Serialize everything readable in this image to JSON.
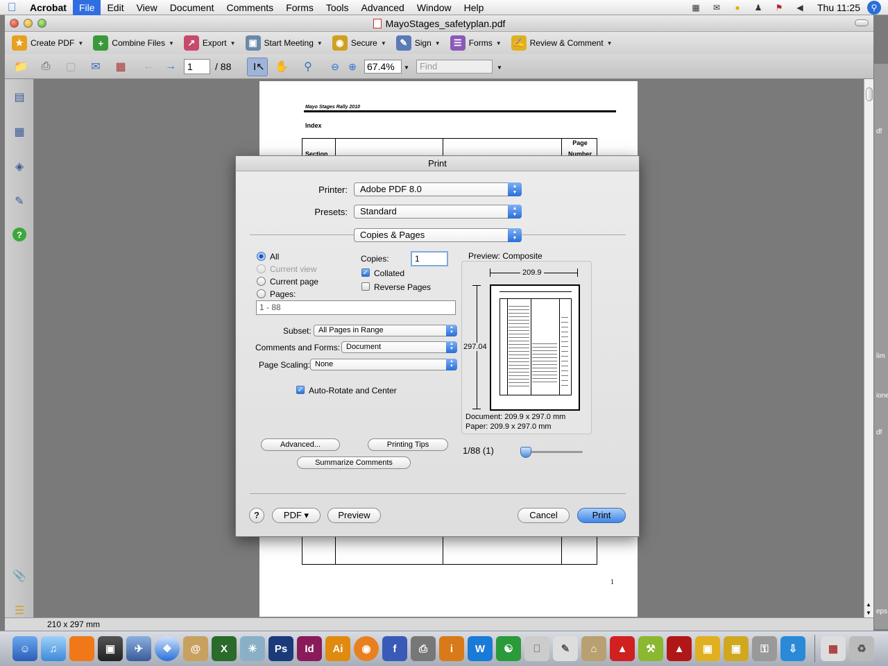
{
  "menubar": {
    "app_name": "Acrobat",
    "items": [
      "File",
      "Edit",
      "View",
      "Document",
      "Comments",
      "Forms",
      "Tools",
      "Advanced",
      "Window",
      "Help"
    ],
    "clock": "Thu 11:25"
  },
  "window": {
    "title": "MayoStages_safetyplan.pdf"
  },
  "toolbar": {
    "create_pdf": "Create PDF",
    "combine_files": "Combine Files",
    "export": "Export",
    "start_meeting": "Start Meeting",
    "secure": "Secure",
    "sign": "Sign",
    "forms": "Forms",
    "review_comment": "Review & Comment"
  },
  "navbar": {
    "page_value": "1",
    "page_count": "/ 88",
    "zoom": "67.4%",
    "find_placeholder": "Find"
  },
  "status": {
    "page_size": "210 x 297 mm"
  },
  "document": {
    "header": "Mayo Stages Rally 2010",
    "index_title": "Index",
    "col_section": "Section",
    "col_page": "Page",
    "col_number": "Number",
    "page_number": "1"
  },
  "print_dialog": {
    "title": "Print",
    "printer_label": "Printer:",
    "printer_value": "Adobe PDF 8.0",
    "presets_label": "Presets:",
    "presets_value": "Standard",
    "section_value": "Copies & Pages",
    "range_all": "All",
    "range_current_view": "Current view",
    "range_current_page": "Current page",
    "range_pages": "Pages:",
    "pages_value": "1 - 88",
    "copies_label": "Copies:",
    "copies_value": "1",
    "collated": "Collated",
    "reverse_pages": "Reverse Pages",
    "subset_label": "Subset:",
    "subset_value": "All Pages in Range",
    "comments_forms_label": "Comments and Forms:",
    "comments_forms_value": "Document",
    "page_scaling_label": "Page Scaling:",
    "page_scaling_value": "None",
    "auto_rotate": "Auto-Rotate and Center",
    "preview_label": "Preview: Composite",
    "width_dim": "209.9",
    "height_dim": "297.04",
    "document_size": "Document: 209.9 x 297.0 mm",
    "paper_size": "Paper: 209.9 x 297.0 mm",
    "advanced_btn": "Advanced...",
    "printing_tips_btn": "Printing Tips",
    "summarize_btn": "Summarize Comments",
    "page_indicator": "1/88 (1)",
    "help_btn": "?",
    "pdf_btn": "PDF ▾",
    "preview_btn": "Preview",
    "cancel_btn": "Cancel",
    "print_btn": "Print"
  },
  "right_edge_text": [
    "df",
    "lim",
    "ione",
    "df",
    "eps"
  ],
  "dock": {
    "ps": "Ps",
    "id": "Id",
    "ai": "Ai"
  }
}
